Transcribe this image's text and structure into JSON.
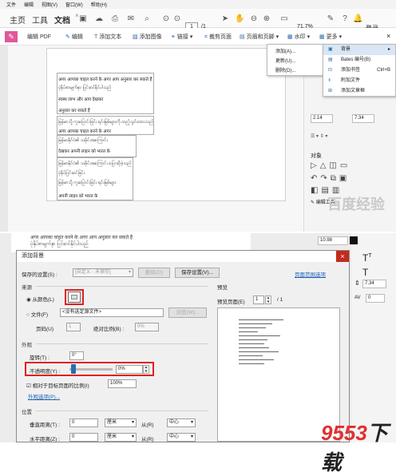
{
  "menubar": {
    "items": [
      "文件",
      "编辑",
      "视图(V)",
      "窗口(W)",
      "帮助(H)"
    ]
  },
  "tabs": [
    {
      "label": "主页"
    },
    {
      "label": "工具"
    },
    {
      "label": "文档"
    }
  ],
  "nav": {
    "page_current": "1",
    "page_total": "/1",
    "zoom": "71.7%",
    "login": "登录"
  },
  "toolbar2": {
    "edit_pdf": "编辑 PDF",
    "edit": "编辑",
    "add_text": "添加文本",
    "add_image": "添加图像",
    "link": "链接",
    "crop": "裁剪页面",
    "header_footer": "页眉和页脚",
    "watermark": "水印",
    "more": "更多"
  },
  "more_menu": {
    "items": [
      "添加(A)...",
      "更新(U)...",
      "删除(D)..."
    ]
  },
  "bg_menu": {
    "items": [
      {
        "label": "背景",
        "shortcut": "",
        "selected": true
      },
      {
        "label": "Bates 编号(B)",
        "shortcut": ""
      },
      {
        "label": "添加书签",
        "shortcut": "Ctrl+B"
      },
      {
        "label": "附加文件",
        "shortcut": ""
      },
      {
        "label": "添加文章框",
        "shortcut": ""
      }
    ]
  },
  "doc": {
    "lines": [
      "अगर आपका चाहत करने के अगर आप अनुसार कर सकते हैं",
      "ပုံနှိပ်စာမျက်နှာ ပြင်ဆင်နိုင်ပါသည်",
      "स्वस्थ लाभ और आप देखकर",
      "अनुसार कर सकते हैं",
      "မြန်မာသို့ ကူးပြောင်းခြင်း ရင်းမြစ်များကို ထည့်သွင်းထားသည်",
      "अगर आपका चाहत करने के अगर",
      "မြန်မာနိုင်ငံ၏ သမိုင်းအကြောင်း",
      "देखकर अपनी लाइन को भारत के",
      "မြန်မာနိုင်ငံ၏ သမိုင်းအကြောင်း ပြောဆိုခဲ့သည်",
      "ပုံနှိပ်ပြင်ဆင်ခြင်း",
      "မြန်မာသို့ ကူးပြောင်းခြင်း ရင်းမြစ်များ",
      "अपनी लाइन को भारत के"
    ]
  },
  "right_panel": {
    "font_size_a": "2.14",
    "font_size_b": "7.34",
    "objects_label": "对象",
    "edit_tool_label": "编辑工具..."
  },
  "dialog": {
    "title": "添加背景",
    "close": "×",
    "saved_settings_label": "保存的设置(S) :",
    "saved_settings_value": "[自定义 - 未保存]",
    "delete_btn": "删除(D)",
    "save_settings_btn": "保存设置(V)...",
    "page_range_link": "页面范围选项",
    "source_label": "来源",
    "from_color_label": "从颜色(L)",
    "file_label": "文件(F)",
    "file_placeholder": "<没有选定源文件>",
    "browse_btn": "浏览(W)...",
    "page_num_label": "页码(U)",
    "page_num_value": "1",
    "abs_scale_label": "绝对比例(B) :",
    "abs_scale_value": "0%",
    "appearance_label": "外观",
    "rotation_label": "旋转(T) :",
    "rotation_value": "0°",
    "opacity_label": "不透明度(Y) :",
    "opacity_value": "0%",
    "opacity_fraction": 0.0,
    "relative_scale_label": "相对于目标页面的比例(I)",
    "relative_scale_value": "100%",
    "appearance_options_link": "外观选项(P)...",
    "position_label": "位置",
    "vertical_label": "垂直距离(T) :",
    "vertical_value": "0",
    "horizontal_label": "水平距离(Z) :",
    "horizontal_value": "0",
    "unit_value": "厘米",
    "from_label": "从(R)",
    "from_value": "中心",
    "preview_label": "预览",
    "preview_page_label": "预览页面(E)",
    "preview_page_value": "1",
    "preview_total": "/ 1"
  },
  "side_bottom": {
    "font_size": "10.98",
    "size_b": "7.34",
    "av": "AV",
    "av_value": "0"
  },
  "watermark": {
    "top": "百度经验",
    "brand_a": "9553",
    "brand_b": "下载"
  },
  "colors": {
    "accent_blue": "#2b6cb0",
    "close_red": "#c42b1c",
    "highlight_red": "#e02020"
  }
}
